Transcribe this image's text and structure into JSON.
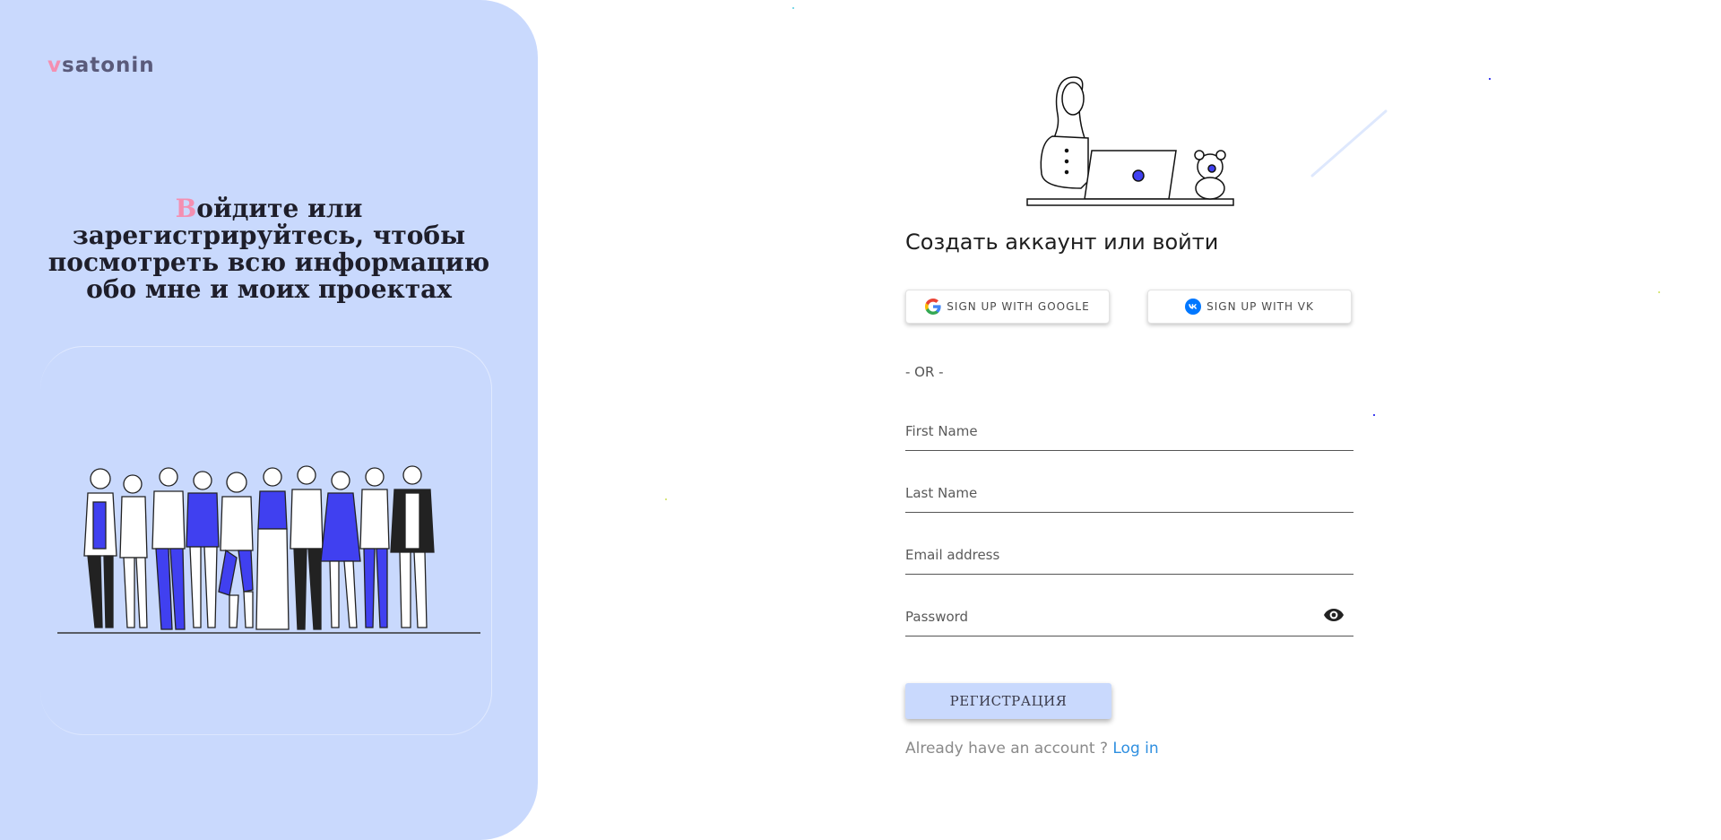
{
  "brand": {
    "logo_accent": "v",
    "logo_rest": "satonin"
  },
  "hero": {
    "dropcap": "В",
    "headline_rest": "ойдите или зарегистрируйтесь, чтобы посмотреть всю информацию обо мне и моих проектах"
  },
  "form": {
    "title": "Создать аккаунт или войти",
    "google_button": "SIGN UP WITH GOOGLE",
    "vk_button": "SIGN UP WITH VK",
    "divider": "- OR -",
    "first_name_label": "First Name",
    "last_name_label": "Last Name",
    "email_label": "Email address",
    "password_label": "Password",
    "submit_label": "РЕГИСТРАЦИЯ",
    "login_prompt": "Already have an account ?",
    "login_link": "Log in"
  },
  "icons": [
    "google-icon",
    "vk-icon",
    "eye-icon"
  ],
  "colors": {
    "panel_bg": "#c9d9fd",
    "accent_pink": "#f48fb1",
    "illustration_blue": "#4040f0",
    "link_blue": "#2f8fe0"
  }
}
